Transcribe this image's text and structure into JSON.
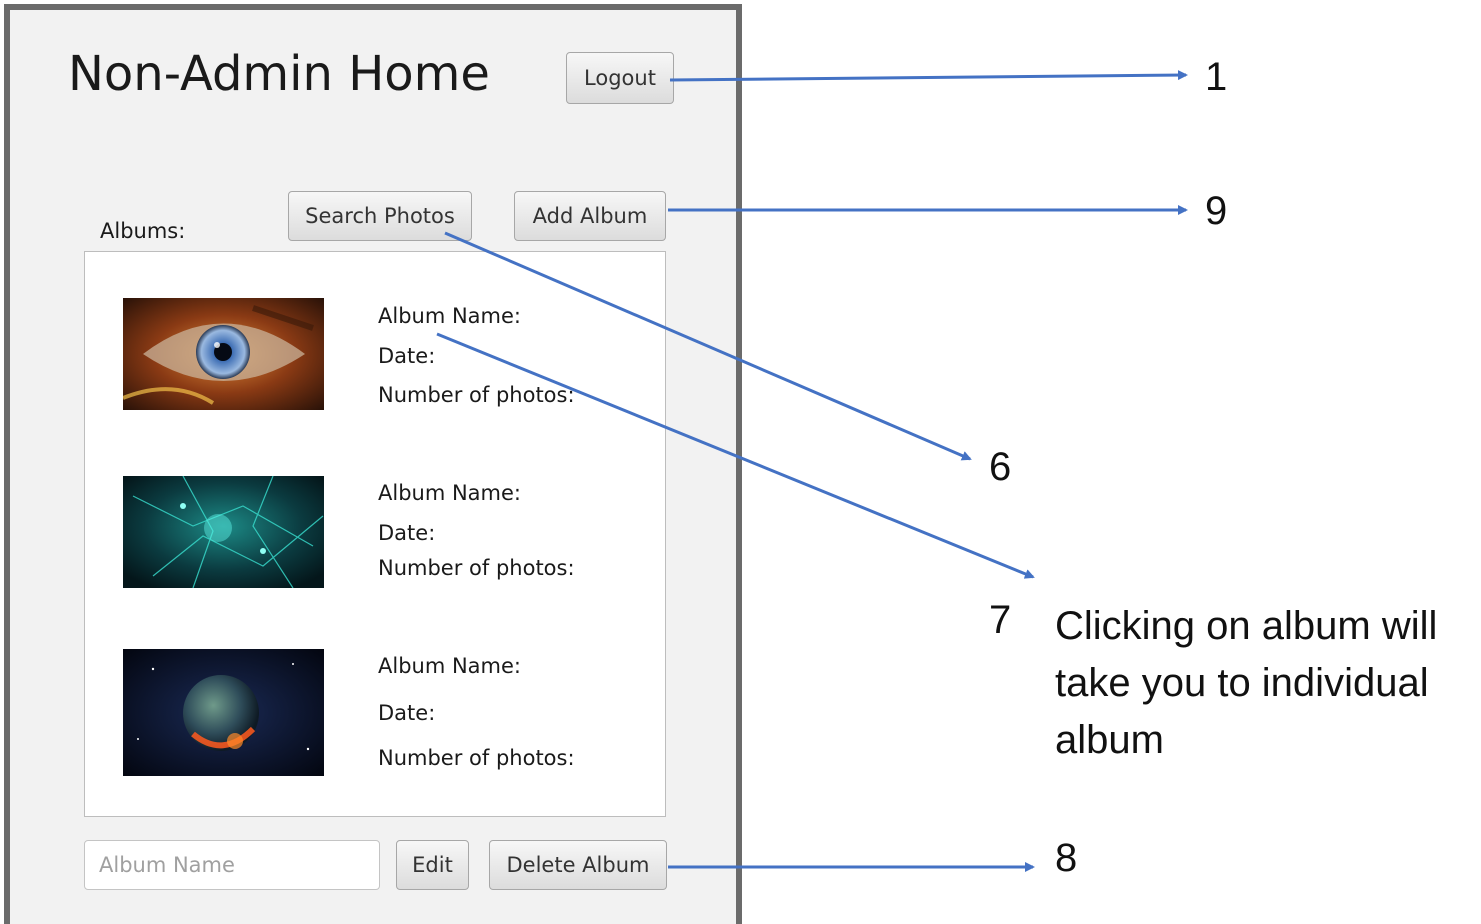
{
  "window": {
    "title": "Non-Admin Home",
    "logout_label": "Logout",
    "search_label": "Search Photos",
    "add_label": "Add Album",
    "albums_label": "Albums:",
    "edit_label": "Edit",
    "delete_label": "Delete Album",
    "album_name_placeholder": "Album Name",
    "albums": [
      {
        "name_label": "Album Name:",
        "date_label": "Date:",
        "count_label": "Number of photos:",
        "thumbnail": "eye-image"
      },
      {
        "name_label": "Album Name:",
        "date_label": "Date:",
        "count_label": "Number of photos:",
        "thumbnail": "teal-network-image"
      },
      {
        "name_label": "Album Name:",
        "date_label": "Date:",
        "count_label": "Number of photos:",
        "thumbnail": "earth-space-image"
      }
    ]
  },
  "annotations": {
    "n1": "1",
    "n9": "9",
    "n6": "6",
    "n7": "7",
    "n7_text": "Clicking on album will take you to individual album",
    "n8": "8",
    "arrow_color": "#4472c4"
  }
}
